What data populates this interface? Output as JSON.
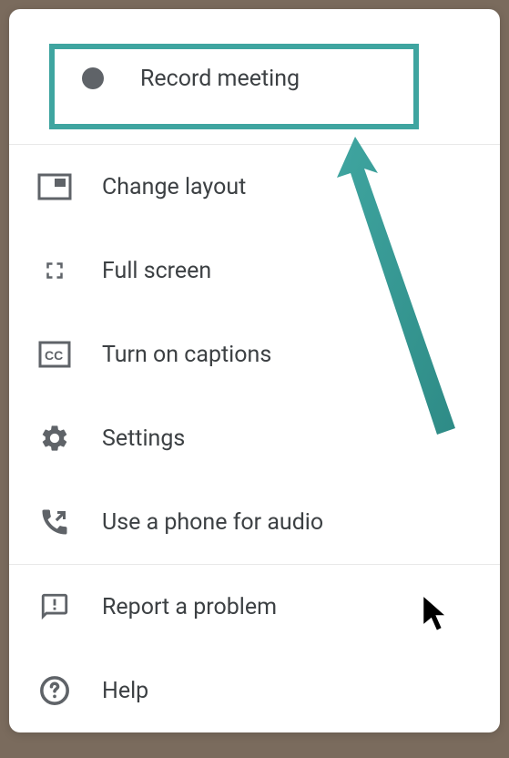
{
  "colors": {
    "highlight": "#3fa5a0",
    "text": "#3c4043",
    "icon": "#5f6368",
    "divider": "#e8e8e8",
    "bg": "#ffffff"
  },
  "menu": {
    "sections": [
      {
        "items": [
          {
            "id": "record",
            "label": "Record meeting",
            "icon": "record-icon",
            "highlighted": true
          }
        ]
      },
      {
        "items": [
          {
            "id": "layout",
            "label": "Change layout",
            "icon": "layout-icon"
          },
          {
            "id": "fullscreen",
            "label": "Full screen",
            "icon": "fullscreen-icon"
          },
          {
            "id": "captions",
            "label": "Turn on captions",
            "icon": "captions-icon"
          },
          {
            "id": "settings",
            "label": "Settings",
            "icon": "settings-icon"
          },
          {
            "id": "phone",
            "label": "Use a phone for audio",
            "icon": "phone-icon"
          }
        ]
      },
      {
        "items": [
          {
            "id": "report",
            "label": "Report a problem",
            "icon": "feedback-icon"
          },
          {
            "id": "help",
            "label": "Help",
            "icon": "help-icon"
          }
        ]
      }
    ]
  }
}
